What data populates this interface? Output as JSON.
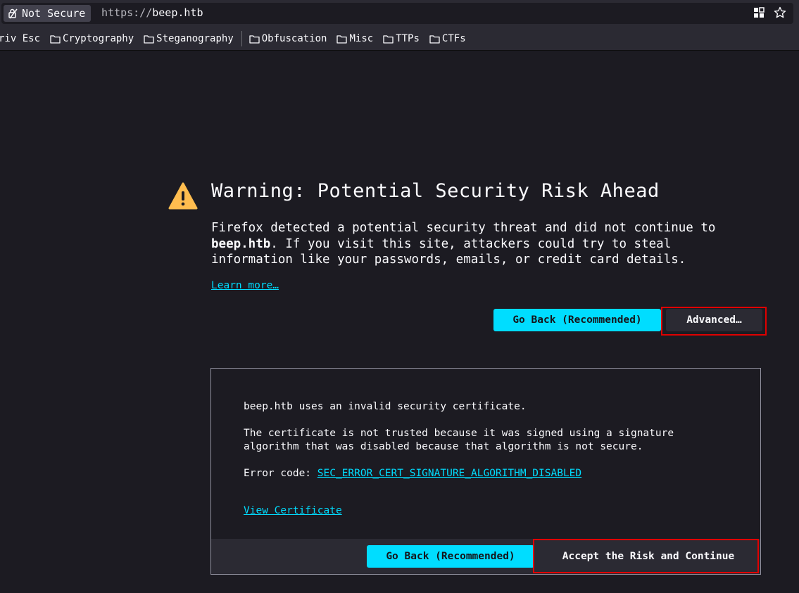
{
  "urlbar": {
    "security_label": "Not Secure",
    "url_scheme": "https://",
    "url_host": "beep.htb",
    "icons": [
      "padlock-warning-icon",
      "extensions-grid-icon",
      "star-icon"
    ]
  },
  "bookmarks": [
    {
      "label": "riv Esc",
      "icon": null
    },
    {
      "label": "Cryptography",
      "icon": "folder-icon"
    },
    {
      "label": "Steganography",
      "icon": "folder-icon"
    },
    {
      "label": "Obfuscation",
      "icon": "folder-icon"
    },
    {
      "label": "Misc",
      "icon": "folder-icon"
    },
    {
      "label": "TTPs",
      "icon": "folder-icon"
    },
    {
      "label": "CTFs",
      "icon": "folder-icon"
    }
  ],
  "warning": {
    "title": "Warning: Potential Security Risk Ahead",
    "desc_before": "Firefox detected a potential security threat and did not continue to",
    "desc_host": "beep.htb",
    "desc_after": ". If you visit this site, attackers could try to steal information like your passwords, emails, or credit card details.",
    "learn_more": "Learn more…",
    "go_back": "Go Back (Recommended)",
    "advanced": "Advanced…"
  },
  "advanced_panel": {
    "line1": "beep.htb uses an invalid security certificate.",
    "line2": "The certificate is not trusted because it was signed using a signature algorithm that was disabled because that algorithm is not secure.",
    "error_prefix": "Error code: ",
    "error_code": "SEC_ERROR_CERT_SIGNATURE_ALGORITHM_DISABLED",
    "view_certificate": "View Certificate",
    "go_back": "Go Back (Recommended)",
    "accept": "Accept the Risk and Continue"
  },
  "colors": {
    "background": "#1c1b22",
    "accent": "#00ddff",
    "highlight": "#e00000",
    "warning_icon": "#ffbd4f"
  }
}
